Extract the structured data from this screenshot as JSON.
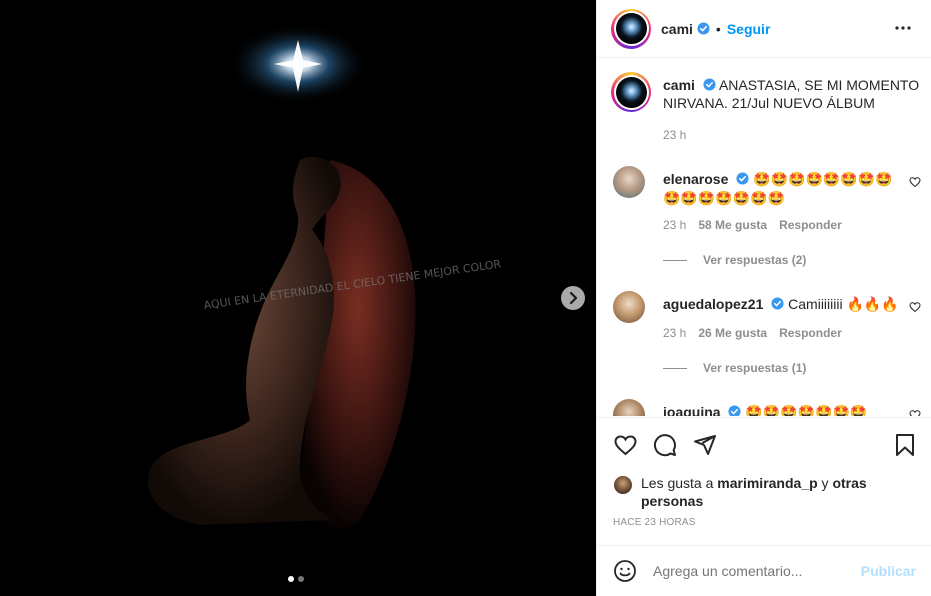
{
  "post": {
    "username": "cami",
    "follow_label": "Seguir",
    "separator": "•",
    "caption_text": "ANASTASIA, SE MI MOMENTO NIRVANA. 21/Jul NUEVO ÁLBUM",
    "caption_time": "23 h",
    "image_overlay_text": "AQUI EN LA ETERNIDAD EL CIELO TIENE MEJOR COLOR",
    "carousel": {
      "current": 1,
      "total": 2
    }
  },
  "comments": [
    {
      "username": "elenarose",
      "text": "🤩🤩🤩🤩🤩🤩🤩🤩🤩🤩🤩🤩🤩🤩🤩",
      "time": "23 h",
      "likes": "58 Me gusta",
      "reply_label": "Responder",
      "view_replies": "Ver respuestas (2)"
    },
    {
      "username": "aguedalopez21",
      "text": "Camiiiiiiii 🔥🔥🔥",
      "time": "23 h",
      "likes": "26 Me gusta",
      "reply_label": "Responder",
      "view_replies": "Ver respuestas (1)"
    },
    {
      "username": "joaquina",
      "text": "🤩🤩🤩🤩🤩🤩🤩"
    }
  ],
  "likes_summary": {
    "prefix": "Les gusta a",
    "user": "marimiranda_p",
    "conj": "y",
    "others": "otras personas"
  },
  "posted_ago": "HACE 23 HORAS",
  "add_comment": {
    "placeholder": "Agrega un comentario...",
    "post_label": "Publicar"
  },
  "icons": [
    "verified-icon",
    "more-options-icon",
    "heart-icon",
    "comment-icon",
    "share-icon",
    "bookmark-icon",
    "emoji-icon",
    "chevron-right-icon"
  ],
  "colors": {
    "link": "#0095f6",
    "verified": "#3897f0",
    "muted": "#8e8e8e",
    "post_disabled": "#b2dffc"
  }
}
